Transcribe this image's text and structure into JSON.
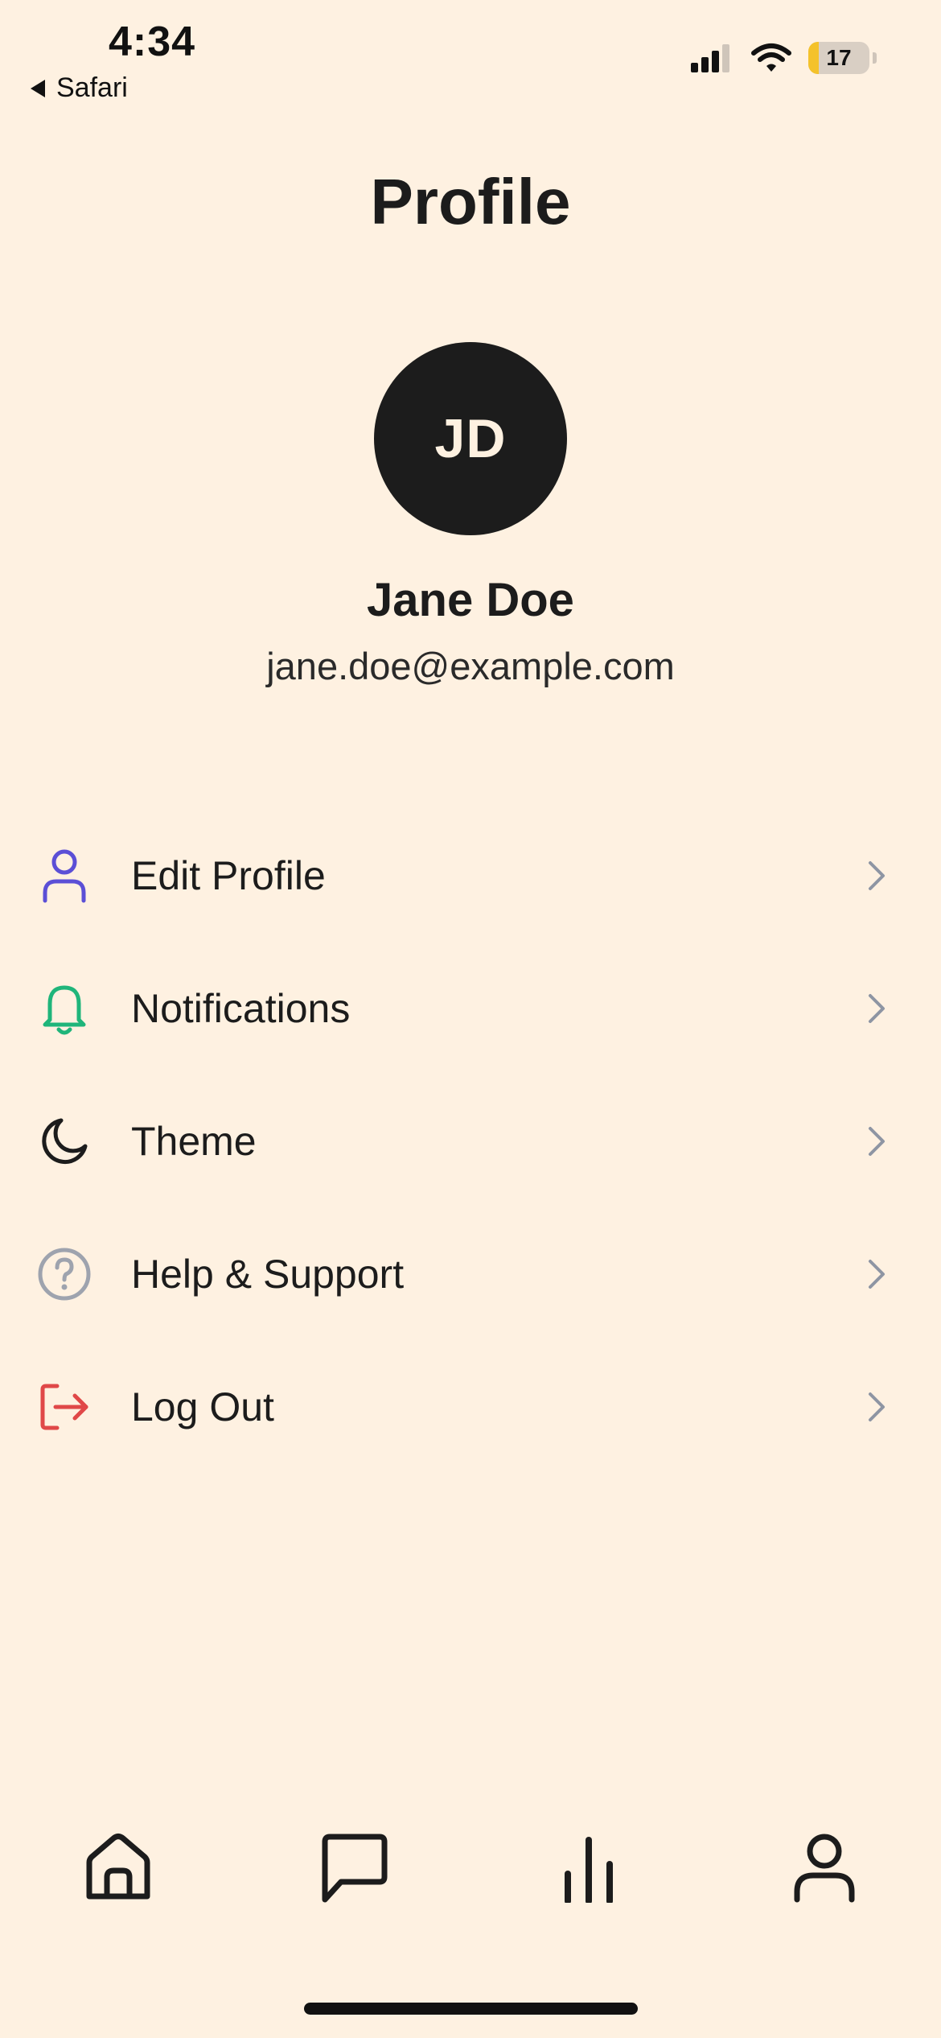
{
  "status_bar": {
    "time": "4:34",
    "back_app": "Safari",
    "battery_level": "17",
    "battery_fraction": 0.17,
    "battery_color": "#F4C22B"
  },
  "page": {
    "title": "Profile"
  },
  "profile": {
    "initials": "JD",
    "name": "Jane Doe",
    "email": "jane.doe@example.com"
  },
  "menu": {
    "items": [
      {
        "label": "Edit Profile",
        "icon": "user-icon",
        "color": "#5B4FD6"
      },
      {
        "label": "Notifications",
        "icon": "bell-icon",
        "color": "#1FB57A"
      },
      {
        "label": "Theme",
        "icon": "moon-icon",
        "color": "#1C1C1C"
      },
      {
        "label": "Help & Support",
        "icon": "help-circle-icon",
        "color": "#9EA3AE"
      },
      {
        "label": "Log Out",
        "icon": "logout-icon",
        "color": "#E04848"
      }
    ]
  },
  "bottom_nav": {
    "items": [
      {
        "icon": "home-icon"
      },
      {
        "icon": "chat-icon"
      },
      {
        "icon": "stats-icon"
      },
      {
        "icon": "profile-icon"
      }
    ]
  },
  "colors": {
    "background": "#FEF1E1",
    "text": "#1C1C1C",
    "chevron": "#8E95A3"
  }
}
